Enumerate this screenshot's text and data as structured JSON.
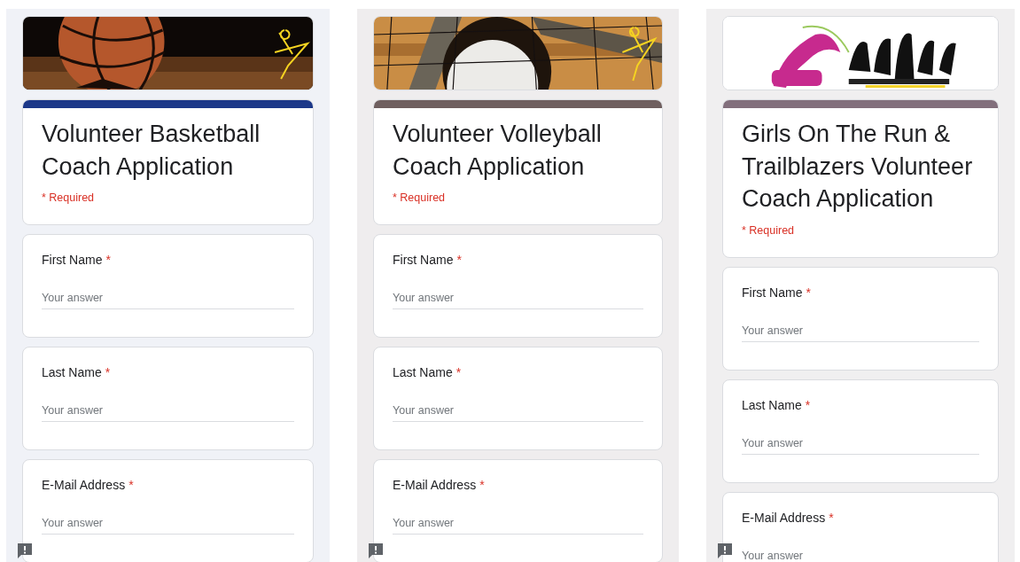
{
  "forms": [
    {
      "color": "#1c3889",
      "title": "Volunteer Basketball Coach Application",
      "required_note": "* Required",
      "questions": [
        {
          "label": "First Name",
          "mark": "*",
          "placeholder": "Your answer"
        },
        {
          "label": "Last Name",
          "mark": "*",
          "placeholder": "Your answer"
        },
        {
          "label": "E-Mail Address",
          "mark": "*",
          "placeholder": "Your answer"
        }
      ]
    },
    {
      "color": "#6f5f5f",
      "title": "Volunteer Volleyball Coach Application",
      "required_note": "* Required",
      "questions": [
        {
          "label": "First Name",
          "mark": "*",
          "placeholder": "Your answer"
        },
        {
          "label": "Last Name",
          "mark": "*",
          "placeholder": "Your answer"
        },
        {
          "label": "E-Mail Address",
          "mark": "*",
          "placeholder": "Your answer"
        }
      ]
    },
    {
      "color": "#826f7c",
      "title": "Girls On The Run & Trailblazers Volunteer Coach Application",
      "required_note": "* Required",
      "questions": [
        {
          "label": "First Name",
          "mark": "*",
          "placeholder": "Your answer"
        },
        {
          "label": "Last Name",
          "mark": "*",
          "placeholder": "Your answer"
        },
        {
          "label": "E-Mail Address",
          "mark": "*",
          "placeholder": "Your answer"
        }
      ]
    }
  ]
}
